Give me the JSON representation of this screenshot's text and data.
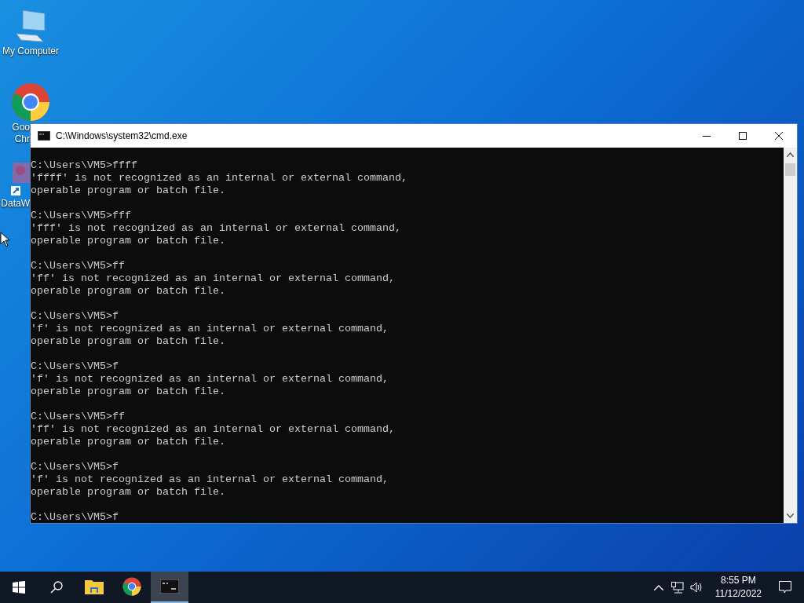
{
  "desktop_icons": [
    {
      "kind": "computer",
      "clipped": false,
      "lines": [
        "My Computer"
      ]
    },
    {
      "kind": "chrome",
      "clipped": true,
      "lines": [
        "Goo",
        "Chr"
      ]
    },
    {
      "kind": "app",
      "clipped": true,
      "lines": [
        "DataW"
      ]
    }
  ],
  "window": {
    "title": "C:\\Windows\\system32\\cmd.exe",
    "console": [
      {
        "prompt": "C:\\Users\\VM5>ffff",
        "output": [
          "'ffff' is not recognized as an internal or external command,",
          "operable program or batch file."
        ]
      },
      {
        "prompt": "C:\\Users\\VM5>fff",
        "output": [
          "'fff' is not recognized as an internal or external command,",
          "operable program or batch file."
        ]
      },
      {
        "prompt": "C:\\Users\\VM5>ff",
        "output": [
          "'ff' is not recognized as an internal or external command,",
          "operable program or batch file."
        ]
      },
      {
        "prompt": "C:\\Users\\VM5>f",
        "output": [
          "'f' is not recognized as an internal or external command,",
          "operable program or batch file."
        ]
      },
      {
        "prompt": "C:\\Users\\VM5>f",
        "output": [
          "'f' is not recognized as an internal or external command,",
          "operable program or batch file."
        ]
      },
      {
        "prompt": "C:\\Users\\VM5>ff",
        "output": [
          "'ff' is not recognized as an internal or external command,",
          "operable program or batch file."
        ]
      },
      {
        "prompt": "C:\\Users\\VM5>f",
        "output": [
          "'f' is not recognized as an internal or external command,",
          "operable program or batch file."
        ]
      },
      {
        "prompt": "C:\\Users\\VM5>f"
      }
    ]
  },
  "taskbar": {
    "apps": [
      {
        "kind": "explorer",
        "selected": false
      },
      {
        "kind": "chrome",
        "selected": false
      },
      {
        "kind": "cmd",
        "selected": true
      }
    ],
    "time": "8:55 PM",
    "date": "11/12/2022"
  }
}
